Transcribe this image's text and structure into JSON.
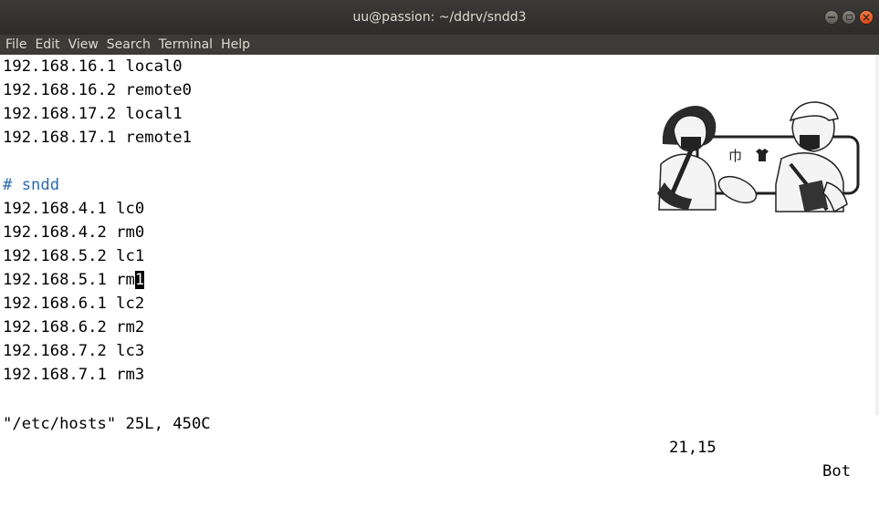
{
  "window": {
    "title": "uu@passion: ~/ddrv/sndd3"
  },
  "menu": [
    "File",
    "Edit",
    "View",
    "Search",
    "Terminal",
    "Help"
  ],
  "lines": [
    "192.168.16.1 local0",
    "192.168.16.2 remote0",
    "192.168.17.2 local1",
    "192.168.17.1 remote1",
    "",
    "# sndd",
    "192.168.4.1 lc0",
    "192.168.4.2 rm0",
    "192.168.5.2 lc1",
    "192.168.5.1 rm",
    "192.168.6.1 lc2",
    "192.168.6.2 rm2",
    "192.168.7.2 lc3",
    "192.168.7.1 rm3"
  ],
  "cursor_char": "1",
  "status": {
    "file": "\"/etc/hosts\" 25L, 450C",
    "position": "21,15",
    "scroll": "Bot"
  },
  "icons": {
    "close": "close-icon",
    "maximize": "maximize-icon",
    "minimize": "minimize-icon"
  },
  "colors": {
    "titlebar": "#3c3b37",
    "close_button": "#dd4814",
    "comment": "#2a6bb0",
    "background": "#ffffff"
  }
}
